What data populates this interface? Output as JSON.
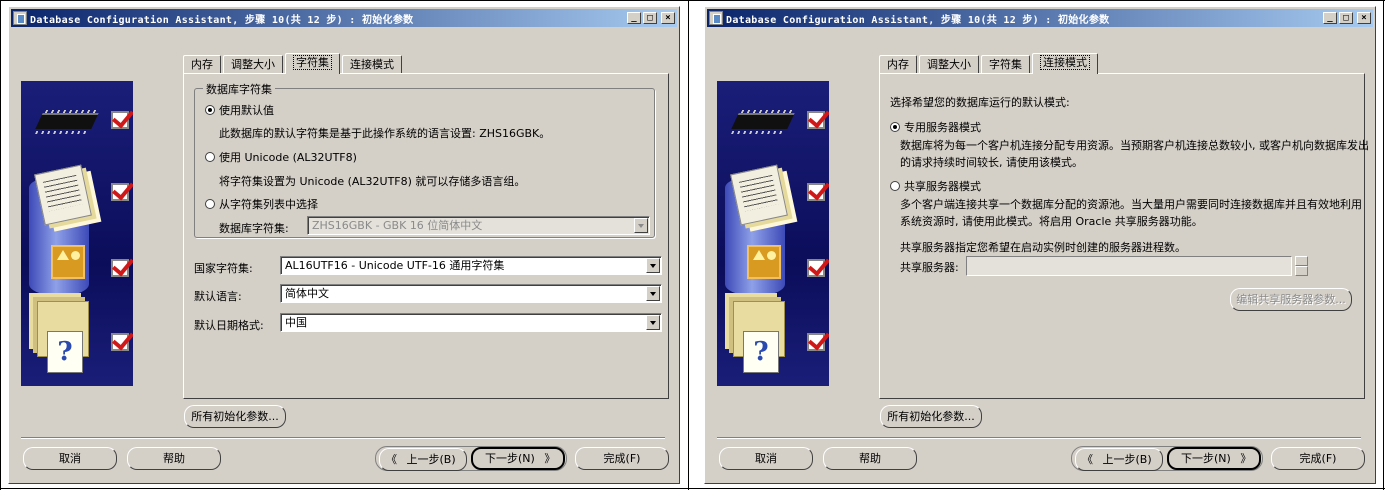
{
  "left": {
    "window": {
      "title": "Database Configuration Assistant, 步骤 10(共 12 步) : 初始化参数",
      "buttons": {
        "minimize": "_",
        "maximize": "□",
        "close": "×"
      }
    },
    "tabs": [
      {
        "label": "内存",
        "active": false
      },
      {
        "label": "调整大小",
        "active": false
      },
      {
        "label": "字符集",
        "active": true
      },
      {
        "label": "连接模式",
        "active": false
      }
    ],
    "db_charset": {
      "legend": "数据库字符集",
      "option_default": "使用默认值",
      "option_default_desc": "此数据库的默认字符集是基于此操作系统的语言设置: ZHS16GBK。",
      "option_unicode": "使用 Unicode (AL32UTF8)",
      "option_unicode_desc": "将字符集设置为 Unicode (AL32UTF8) 就可以存储多语言组。",
      "option_list": "从字符集列表中选择",
      "list_label": "数据库字符集:",
      "list_value": "ZHS16GBK - GBK 16 位简体中文",
      "selected": "default"
    },
    "national_charset": {
      "label": "国家字符集:",
      "value": "AL16UTF16 - Unicode UTF-16 通用字符集"
    },
    "default_language": {
      "label": "默认语言:",
      "value": "简体中文"
    },
    "default_date_format": {
      "label": "默认日期格式:",
      "value": "中国"
    },
    "all_params_button": "所有初始化参数...",
    "footer": {
      "cancel": "取消",
      "help": "帮助",
      "back": "上一步(B)",
      "back_glyph": "《",
      "next": "下一步(N)",
      "next_glyph": "》",
      "finish": "完成(F)"
    }
  },
  "right": {
    "window": {
      "title": "Database Configuration Assistant, 步骤 10(共 12 步) : 初始化参数",
      "buttons": {
        "minimize": "_",
        "maximize": "□",
        "close": "×"
      }
    },
    "tabs": [
      {
        "label": "内存",
        "active": false
      },
      {
        "label": "调整大小",
        "active": false
      },
      {
        "label": "字符集",
        "active": false
      },
      {
        "label": "连接模式",
        "active": true
      }
    ],
    "connection": {
      "prompt": "选择希望您的数据库运行的默认模式:",
      "dedicated_label": "专用服务器模式",
      "dedicated_desc_line1": "数据库将为每一个客户机连接分配专用资源。当预期客户机连接总数较小, 或客户机向数据库发出",
      "dedicated_desc_line2": "的请求持续时间较长, 请使用该模式。",
      "shared_label": "共享服务器模式",
      "shared_desc_line1": "多个客户端连接共享一个数据库分配的资源池。当大量用户需要同时连接数据库并且有效地利用",
      "shared_desc_line2": "系统资源时, 请使用此模式。将启用 Oracle 共享服务器功能。",
      "shared_count_note": "共享服务器指定您希望在启动实例时创建的服务器进程数。",
      "shared_server_label": "共享服务器:",
      "shared_server_value": "",
      "edit_shared_params": "编辑共享服务器参数...",
      "selected": "dedicated"
    },
    "all_params_button": "所有初始化参数...",
    "footer": {
      "cancel": "取消",
      "help": "帮助",
      "back": "上一步(B)",
      "back_glyph": "《",
      "next": "下一步(N)",
      "next_glyph": "》",
      "finish": "完成(F)"
    }
  }
}
